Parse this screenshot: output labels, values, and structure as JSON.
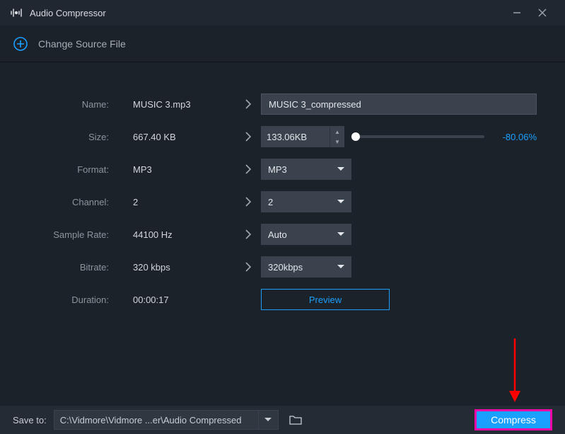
{
  "window": {
    "title": "Audio Compressor"
  },
  "source": {
    "change_label": "Change Source File"
  },
  "fields": {
    "name": {
      "label": "Name:",
      "current": "MUSIC 3.mp3",
      "new_value": "MUSIC 3_compressed"
    },
    "size": {
      "label": "Size:",
      "current": "667.40 KB",
      "new_value": "133.06KB",
      "percent": "-80.06%"
    },
    "format": {
      "label": "Format:",
      "current": "MP3",
      "new_value": "MP3"
    },
    "channel": {
      "label": "Channel:",
      "current": "2",
      "new_value": "2"
    },
    "samplerate": {
      "label": "Sample Rate:",
      "current": "44100 Hz",
      "new_value": "Auto"
    },
    "bitrate": {
      "label": "Bitrate:",
      "current": "320 kbps",
      "new_value": "320kbps"
    },
    "duration": {
      "label": "Duration:",
      "current": "00:00:17"
    }
  },
  "preview_label": "Preview",
  "footer": {
    "save_to_label": "Save to:",
    "path": "C:\\Vidmore\\Vidmore ...er\\Audio Compressed",
    "compress_label": "Compress"
  }
}
